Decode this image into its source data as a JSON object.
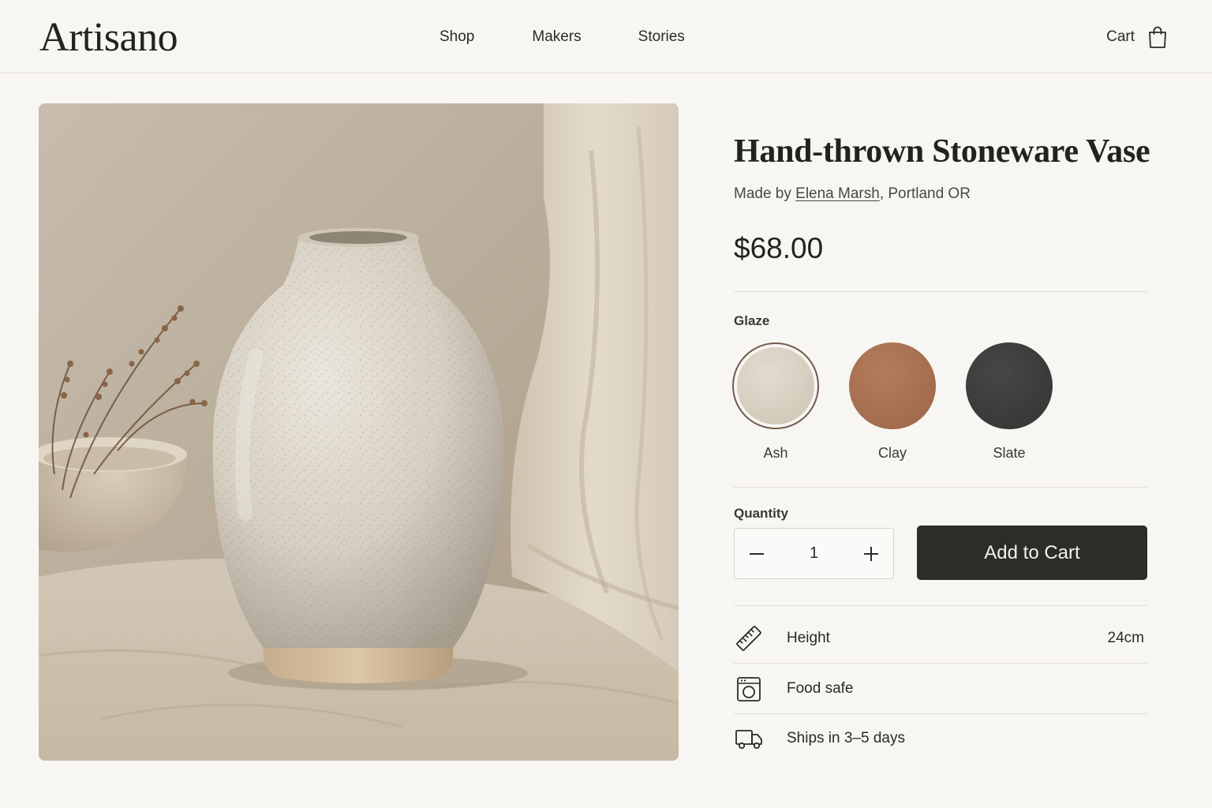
{
  "header": {
    "logo": "Artisano",
    "nav": [
      "Shop",
      "Makers",
      "Stories"
    ],
    "cart_label": "Cart"
  },
  "product": {
    "title": "Hand-thrown Stoneware Vase",
    "made_by_prefix": "Made by ",
    "maker_name": "Elena Marsh",
    "maker_location": ", Portland OR",
    "price": "$68.00",
    "image_alt": "Speckled white stoneware vase on linen cloth"
  },
  "glaze": {
    "label": "Glaze",
    "selected": "Ash",
    "options": [
      {
        "name": "Ash",
        "color": "#d4cbbd"
      },
      {
        "name": "Clay",
        "color": "#a8704f"
      },
      {
        "name": "Slate",
        "color": "#3b3d3b"
      }
    ]
  },
  "quantity": {
    "label": "Quantity",
    "value": "1"
  },
  "actions": {
    "add_to_cart": "Add to Cart"
  },
  "specs": [
    {
      "icon": "ruler-icon",
      "label": "Height",
      "value": "24cm"
    },
    {
      "icon": "food-safe-icon",
      "label": "Food safe",
      "value": ""
    },
    {
      "icon": "truck-icon",
      "label": "Ships in 3–5 days",
      "value": ""
    }
  ],
  "colors": {
    "background": "#f8f6f2",
    "button": "#2d2c28",
    "text": "#2b2a26"
  }
}
